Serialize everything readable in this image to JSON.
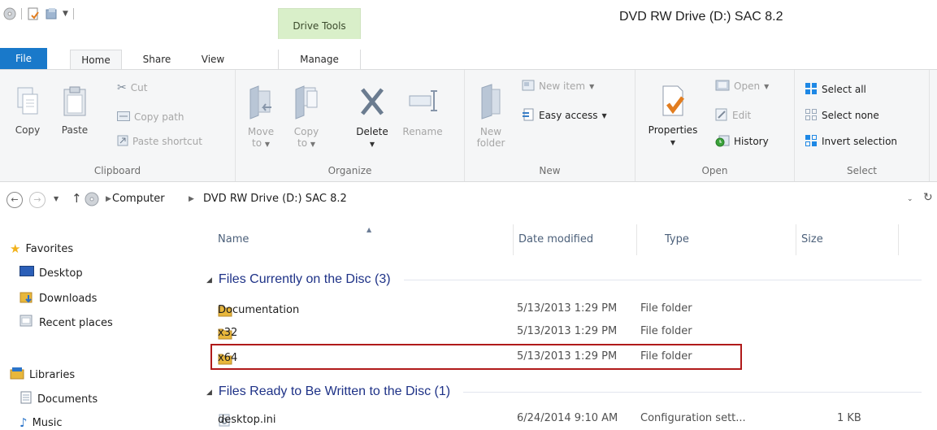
{
  "window": {
    "title": "DVD RW Drive (D:) SAC 8.2",
    "contextual_tab_group": "Drive Tools"
  },
  "ribbon_tabs": [
    {
      "label": "File"
    },
    {
      "label": "Home"
    },
    {
      "label": "Share"
    },
    {
      "label": "View"
    },
    {
      "label": "Manage"
    }
  ],
  "ribbon": {
    "clipboard": {
      "label": "Clipboard",
      "copy": "Copy",
      "paste": "Paste",
      "cut": "Cut",
      "copy_path": "Copy path",
      "paste_shortcut": "Paste shortcut"
    },
    "organize": {
      "label": "Organize",
      "move_to_1": "Move",
      "move_to_2": "to",
      "copy_to_1": "Copy",
      "copy_to_2": "to",
      "delete": "Delete",
      "rename": "Rename"
    },
    "new": {
      "label": "New",
      "new_folder_1": "New",
      "new_folder_2": "folder",
      "new_item": "New item",
      "easy_access": "Easy access"
    },
    "open": {
      "label": "Open",
      "properties": "Properties",
      "open": "Open",
      "edit": "Edit",
      "history": "History"
    },
    "select": {
      "label": "Select",
      "select_all": "Select all",
      "select_none": "Select none",
      "invert_selection": "Invert selection"
    }
  },
  "address": {
    "crumbs": [
      "Computer",
      "DVD RW Drive (D:) SAC 8.2"
    ]
  },
  "navpane": {
    "favorites": "Favorites",
    "desktop": "Desktop",
    "downloads": "Downloads",
    "recent_places": "Recent places",
    "libraries": "Libraries",
    "documents": "Documents",
    "music": "Music"
  },
  "columns": {
    "name": "Name",
    "date": "Date modified",
    "type": "Type",
    "size": "Size"
  },
  "groups": [
    {
      "title": "Files Currently on the Disc (3)",
      "rows": [
        {
          "name": "Documentation",
          "date": "5/13/2013 1:29 PM",
          "type": "File folder",
          "size": ""
        },
        {
          "name": "x32",
          "date": "5/13/2013 1:29 PM",
          "type": "File folder",
          "size": ""
        },
        {
          "name": "x64",
          "date": "5/13/2013 1:29 PM",
          "type": "File folder",
          "size": ""
        }
      ]
    },
    {
      "title": "Files Ready to Be Written to the Disc (1)",
      "rows": [
        {
          "name": "desktop.ini",
          "date": "6/24/2014 9:10 AM",
          "type": "Configuration sett...",
          "size": "1 KB"
        }
      ]
    }
  ],
  "colors": {
    "file_tab": "#1979ca",
    "drive_tools": "#d9efc9",
    "group_header": "#1e3287",
    "highlight_box": "#b01a1a"
  }
}
